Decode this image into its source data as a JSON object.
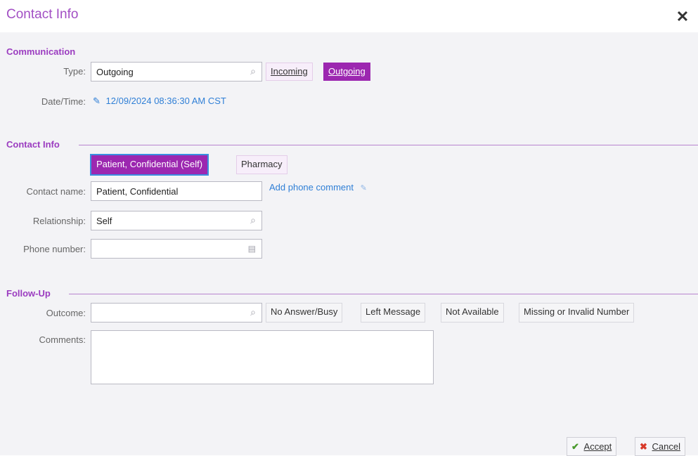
{
  "window": {
    "title": "Contact Info",
    "close_glyph": "✕"
  },
  "communication": {
    "section_title": "Communication",
    "type_label": "Type:",
    "type_value": "Outgoing",
    "incoming_label": "Incoming",
    "outgoing_label": "Outgoing",
    "datetime_label": "Date/Time:",
    "datetime_value": "12/09/2024 08:36:30 AM CST"
  },
  "contact_info": {
    "section_title": "Contact Info",
    "contact_options": [
      "Patient, Confidential (Self)",
      "Pharmacy"
    ],
    "contact_name_label": "Contact name:",
    "contact_name_value": "Patient, Confidential",
    "add_phone_comment": "Add phone comment",
    "relationship_label": "Relationship:",
    "relationship_value": "Self",
    "phone_label": "Phone number:",
    "phone_value": ""
  },
  "follow_up": {
    "section_title": "Follow-Up",
    "outcome_label": "Outcome:",
    "outcome_value": "",
    "outcome_options": [
      "No Answer/Busy",
      "Left Message",
      "Not Available",
      "Missing or Invalid Number"
    ],
    "comments_label": "Comments:",
    "comments_value": ""
  },
  "footer": {
    "accept_label": "Accept",
    "cancel_label": "Cancel"
  },
  "colors": {
    "accent": "#9c27b0",
    "title": "#a24fc4",
    "link": "#2f7fd6"
  }
}
